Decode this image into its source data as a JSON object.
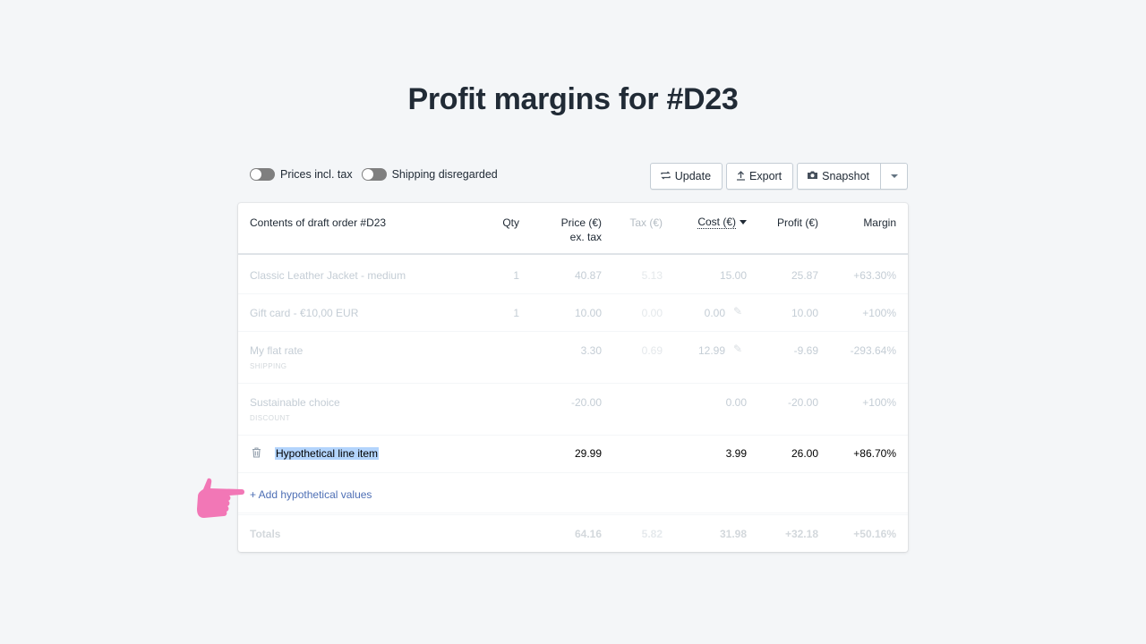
{
  "page": {
    "title": "Profit margins for #D23"
  },
  "toolbar": {
    "toggles": [
      {
        "label": "Prices incl. tax",
        "on": false
      },
      {
        "label": "Shipping disregarded",
        "on": false
      }
    ],
    "buttons": {
      "update": {
        "label": "Update",
        "icon": "refresh-icon"
      },
      "export": {
        "label": "Export",
        "icon": "upload-icon"
      },
      "snapshot": {
        "label": "Snapshot",
        "icon": "camera-icon"
      },
      "more": {
        "icon": "caret-down-icon"
      }
    }
  },
  "table": {
    "headers": {
      "name": "Contents of draft order #D23",
      "qty": "Qty",
      "price_line1": "Price (€)",
      "price_line2": "ex. tax",
      "tax": "Tax (€)",
      "cost": "Cost (€)",
      "profit": "Profit (€)",
      "margin": "Margin"
    },
    "sorted_by": "cost",
    "rows": [
      {
        "name": "Classic Leather Jacket - medium",
        "sub": "",
        "qty": "1",
        "price": "40.87",
        "tax": "5.13",
        "cost": "15.00",
        "editable": false,
        "profit": "25.87",
        "margin": "+63.30%"
      },
      {
        "name": "Gift card - €10,00 EUR",
        "sub": "",
        "qty": "1",
        "price": "10.00",
        "tax": "0.00",
        "cost": "0.00",
        "editable": true,
        "profit": "10.00",
        "margin": "+100%"
      },
      {
        "name": "My flat rate",
        "sub": "SHIPPING",
        "qty": "",
        "price": "3.30",
        "tax": "0.69",
        "cost": "12.99",
        "editable": true,
        "profit": "-9.69",
        "margin": "-293.64%"
      },
      {
        "name": "Sustainable choice",
        "sub": "DISCOUNT",
        "qty": "",
        "price": "-20.00",
        "tax": "",
        "cost": "0.00",
        "editable": false,
        "profit": "-20.00",
        "margin": "+100%"
      }
    ],
    "hypothetical": {
      "name": "Hypothetical line item",
      "price": "29.99",
      "cost": "3.99",
      "profit": "26.00",
      "margin": "+86.70%"
    },
    "add_link": "+ Add hypothetical values",
    "totals": {
      "label": "Totals",
      "price": "64.16",
      "tax": "5.82",
      "cost": "31.98",
      "profit": "+32.18",
      "margin": "+50.16%"
    }
  },
  "annotation": {
    "pointer": "pointing-hand-icon",
    "color": "#f277b6"
  }
}
